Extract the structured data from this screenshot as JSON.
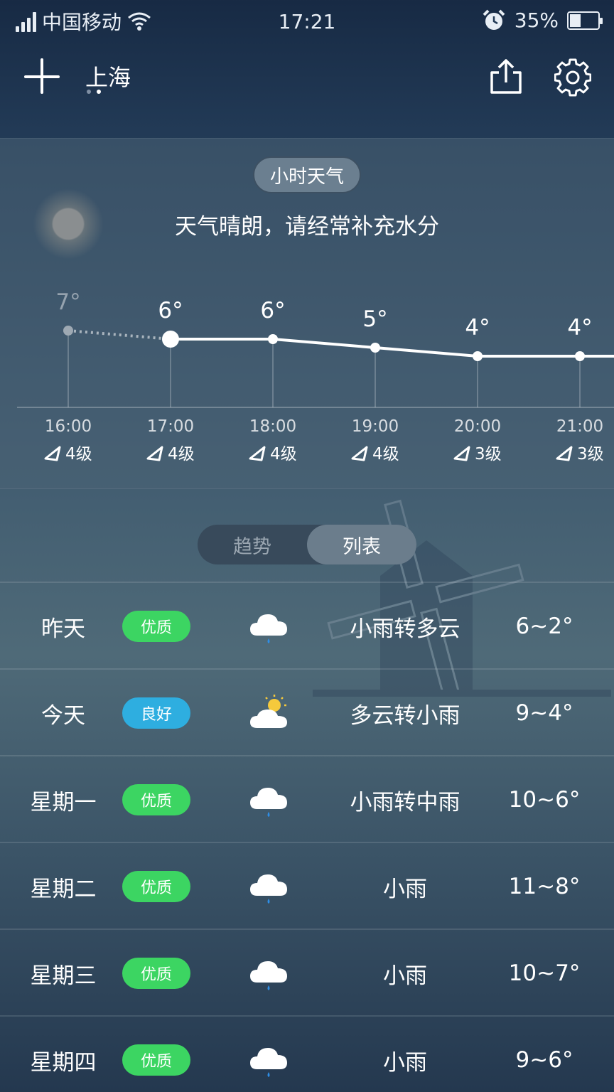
{
  "status_bar": {
    "carrier": "中国移动",
    "time": "17:21",
    "battery": "35%",
    "battery_level": 0.35
  },
  "header": {
    "city": "上海"
  },
  "hourly": {
    "tab_label": "小时天气",
    "tip": "天气晴朗，请经常补充水分",
    "hours": [
      {
        "time": "16:00",
        "temp": "7°",
        "temp_value": 7,
        "wind": "4级",
        "past": true
      },
      {
        "time": "17:00",
        "temp": "6°",
        "temp_value": 6,
        "wind": "4级",
        "current": true
      },
      {
        "time": "18:00",
        "temp": "6°",
        "temp_value": 6,
        "wind": "4级"
      },
      {
        "time": "19:00",
        "temp": "5°",
        "temp_value": 5,
        "wind": "4级"
      },
      {
        "time": "20:00",
        "temp": "4°",
        "temp_value": 4,
        "wind": "3级"
      },
      {
        "time": "21:00",
        "temp": "4°",
        "temp_value": 4,
        "wind": "3级"
      }
    ]
  },
  "forecast": {
    "toggle": {
      "trend": "趋势",
      "list": "列表",
      "selected": "列表"
    },
    "days": [
      {
        "day": "昨天",
        "aqi": "优质",
        "aqi_color": "#3cd562",
        "icon": "light-rain-icon",
        "condition": "小雨转多云",
        "temp": "6~2°"
      },
      {
        "day": "今天",
        "aqi": "良好",
        "aqi_color": "#2eaee0",
        "icon": "partly-cloudy-icon",
        "condition": "多云转小雨",
        "temp": "9~4°"
      },
      {
        "day": "星期一",
        "aqi": "优质",
        "aqi_color": "#3cd562",
        "icon": "light-rain-icon",
        "condition": "小雨转中雨",
        "temp": "10~6°"
      },
      {
        "day": "星期二",
        "aqi": "优质",
        "aqi_color": "#3cd562",
        "icon": "light-rain-icon",
        "condition": "小雨",
        "temp": "11~8°"
      },
      {
        "day": "星期三",
        "aqi": "优质",
        "aqi_color": "#3cd562",
        "icon": "light-rain-icon",
        "condition": "小雨",
        "temp": "10~7°"
      },
      {
        "day": "星期四",
        "aqi": "优质",
        "aqi_color": "#3cd562",
        "icon": "light-rain-icon",
        "condition": "小雨",
        "temp": "9~6°"
      }
    ]
  }
}
